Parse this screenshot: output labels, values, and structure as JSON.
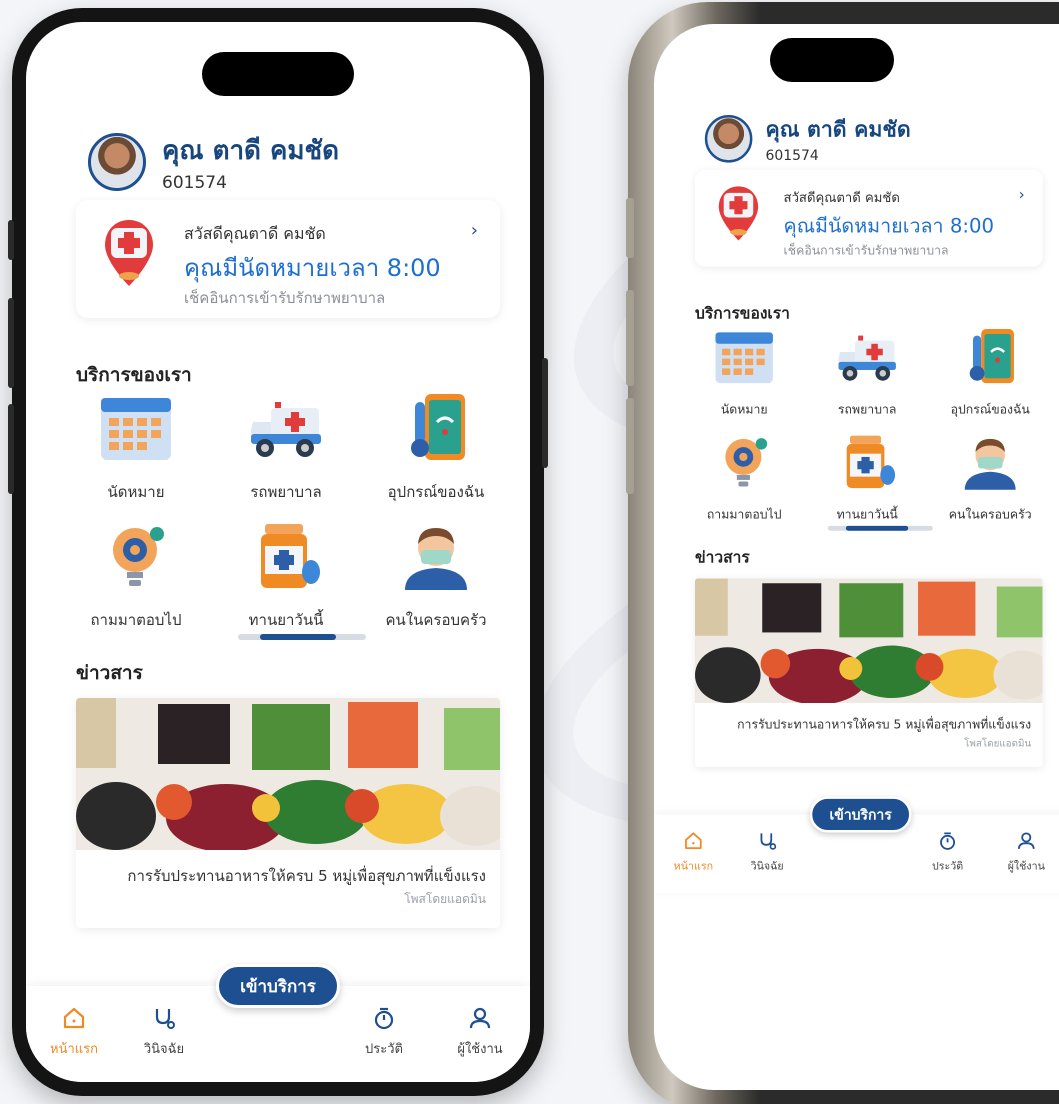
{
  "user": {
    "name": "คุณ ตาดี คมชัด",
    "id": "601574"
  },
  "appointment": {
    "greeting": "สวัสดีคุณตาดี คมชัด",
    "time_text": "คุณมีนัดหมายเวลา 8:00",
    "subtitle": "เช็คอินการเข้ารับรักษาพยาบาล",
    "chevron": "›"
  },
  "services": {
    "title": "บริการของเรา",
    "items": [
      {
        "label": "นัดหมาย",
        "icon": "calendar-icon"
      },
      {
        "label": "รถพยาบาล",
        "icon": "ambulance-icon"
      },
      {
        "label": "อุปกรณ์ของฉัน",
        "icon": "thermometer-device-icon"
      },
      {
        "label": "ถามมาตอบไป",
        "icon": "lightbulb-gear-icon"
      },
      {
        "label": "ทานยาวันนี้",
        "icon": "medicine-bottle-icon"
      },
      {
        "label": "คนในครอบครัว",
        "icon": "family-person-icon"
      }
    ]
  },
  "news": {
    "title": "ข่าวสาร",
    "article_title": "การรับประทานอาหารให้ครบ 5 หมู่เพื่อสุขภาพที่แข็งแรง",
    "author": "โพสโดยแอดมิน"
  },
  "tabbar": {
    "cta": "เข้าบริการ",
    "tabs": [
      {
        "label": "หน้าแรก",
        "icon": "home-icon",
        "active": true
      },
      {
        "label": "วินิจฉัย",
        "icon": "stethoscope-icon",
        "active": false
      },
      {
        "label": "ประวัติ",
        "icon": "history-timer-icon",
        "active": false
      },
      {
        "label": "ผู้ใช้งาน",
        "icon": "user-icon",
        "active": false
      }
    ]
  },
  "colors": {
    "brand": "#1d4f91",
    "accent": "#1d6fd0",
    "active_tab": "#f08a24"
  }
}
